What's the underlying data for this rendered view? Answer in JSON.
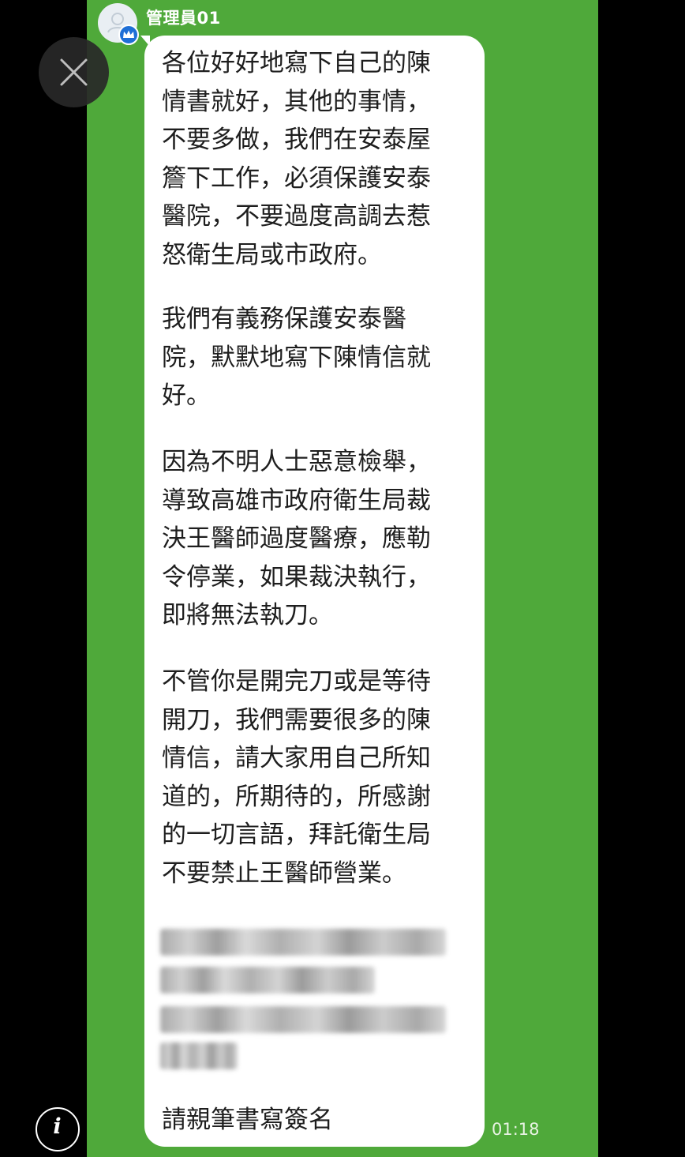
{
  "sender": {
    "name": "管理員01",
    "avatar_icon": "user-avatar-icon",
    "badge_icon": "crown-badge-icon"
  },
  "message": {
    "paragraphs": [
      "各位好好地寫下自己的陳\n情書就好，其他的事情，\n不要多做，我們在安泰屋\n簷下工作，必須保護安泰\n醫院，不要過度高調去惹\n怒衛生局或市政府。",
      "我們有義務保護安泰醫\n院，默默地寫下陳情信就\n好。",
      "因為不明人士惡意檢舉，\n導致高雄市政府衛生局裁\n決王醫師過度醫療，應勒\n令停業，如果裁決執行，\n即將無法執刀。",
      "不管你是開完刀或是等待\n開刀，我們需要很多的陳\n情信，請大家用自己所知\n道的，所期待的，所感謝\n的一切言語，拜託衛生局\n不要禁止王醫師營業。"
    ],
    "redacted_block": "blurred-address-block",
    "closing": "請親筆書寫簽名",
    "time": "01:18"
  },
  "controls": {
    "close_icon": "close-icon",
    "info_icon": "info-icon",
    "info_glyph": "i"
  },
  "colors": {
    "chat_background": "#4fa93a",
    "bubble": "#ffffff",
    "text": "#1e1e1e",
    "side_background": "#000000",
    "badge": "#1f6fd6"
  }
}
